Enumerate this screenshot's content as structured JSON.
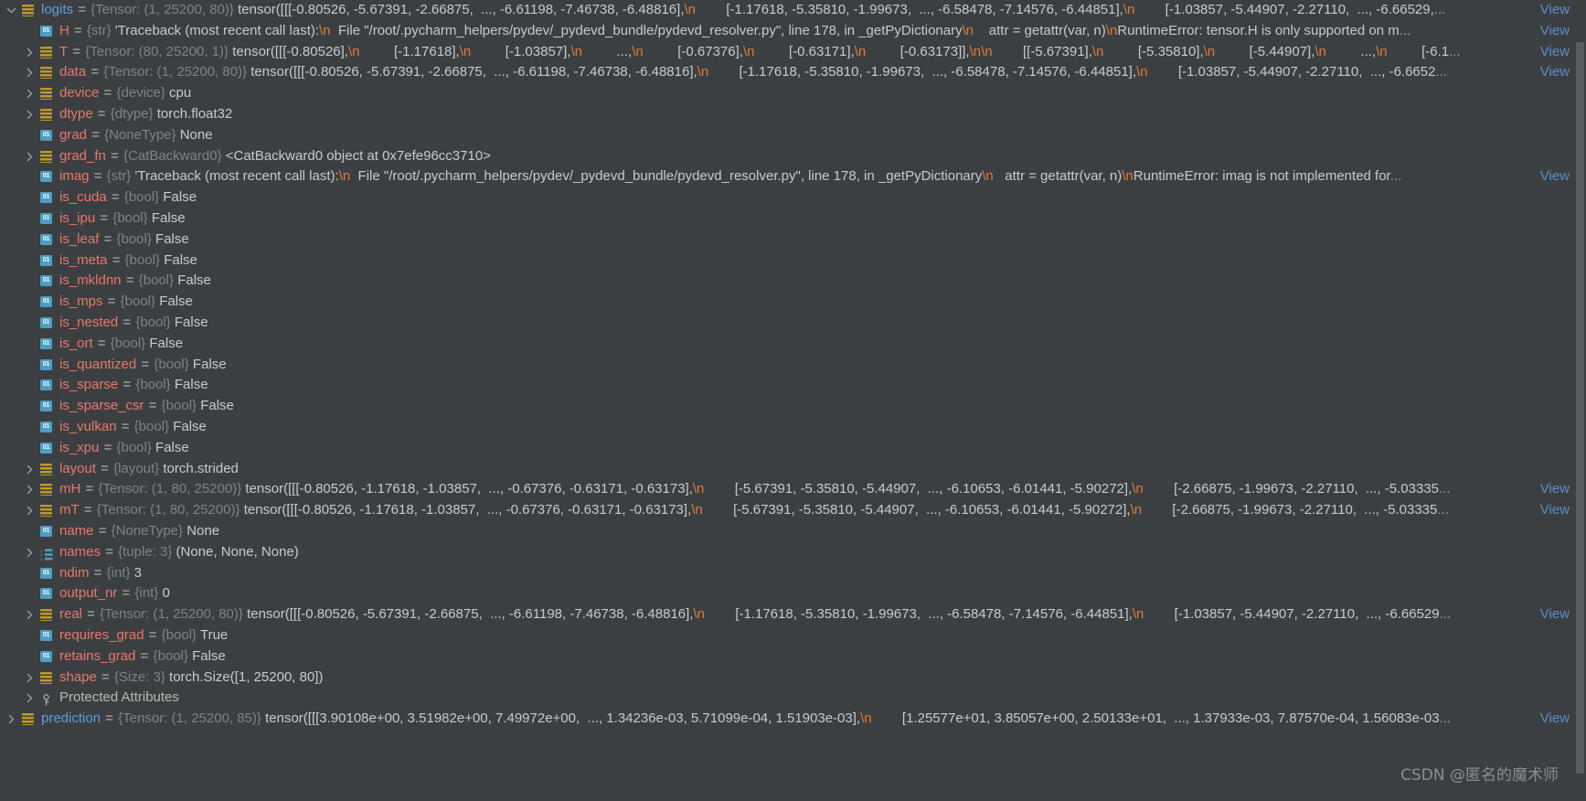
{
  "panel": {
    "title": "Debugger Variables",
    "background": "#3c3f41",
    "accent_name_color": "#e8786e",
    "accent_top_color": "#5f9ee0",
    "type_color": "#7f8386",
    "value_color": "#c8cbcd",
    "escape_color": "#e07a3a",
    "link_color": "#5b8fc9"
  },
  "labels": {
    "view": "View",
    "ellipsis": "...",
    "equals": "="
  },
  "watermark": "CSDN @匿名的魔术师",
  "rows": [
    {
      "id": "logits",
      "indent": 0,
      "expander": "expanded",
      "icon": "object-icon",
      "name": "logits",
      "name_style": "top",
      "type": "{Tensor: (1, 25200, 80)}",
      "value_parts": [
        {
          "t": "tensor([[[-0.80526, -5.67391, -2.66875,  ..., -6.61198, -7.46738, -6.48816],",
          "k": "v"
        },
        {
          "t": "\\n",
          "k": "e"
        },
        {
          "t": "        [-1.17618, -5.35810, -1.99673,  ..., -6.58478, -7.14576, -6.44851],",
          "k": "v"
        },
        {
          "t": "\\n",
          "k": "e"
        },
        {
          "t": "        [-1.03857, -5.44907, -2.27110,  ..., -6.66529,",
          "k": "v"
        }
      ],
      "truncated": true,
      "view": true
    },
    {
      "id": "H",
      "indent": 1,
      "expander": "none",
      "icon": "primitive-icon",
      "name": "H",
      "name_style": "normal",
      "type": "{str}",
      "value_parts": [
        {
          "t": "'Traceback (most recent call last):",
          "k": "v"
        },
        {
          "t": "\\n",
          "k": "e"
        },
        {
          "t": "  File \"/root/.pycharm_helpers/pydev/_pydevd_bundle/pydevd_resolver.py\", line 178, in _getPyDictionary",
          "k": "v"
        },
        {
          "t": "\\n",
          "k": "e"
        },
        {
          "t": "    attr = getattr(var, n)",
          "k": "v"
        },
        {
          "t": "\\n",
          "k": "e"
        },
        {
          "t": "RuntimeError: tensor.H is only supported on m",
          "k": "v"
        }
      ],
      "truncated": true,
      "view": true
    },
    {
      "id": "T",
      "indent": 1,
      "expander": "collapsed",
      "icon": "object-icon",
      "name": "T",
      "name_style": "normal",
      "type": "{Tensor: (80, 25200, 1)}",
      "value_parts": [
        {
          "t": "tensor([[[-0.80526],",
          "k": "v"
        },
        {
          "t": "\\n",
          "k": "e"
        },
        {
          "t": "         [-1.17618],",
          "k": "v"
        },
        {
          "t": "\\n",
          "k": "e"
        },
        {
          "t": "         [-1.03857],",
          "k": "v"
        },
        {
          "t": "\\n",
          "k": "e"
        },
        {
          "t": "         ...,",
          "k": "v"
        },
        {
          "t": "\\n",
          "k": "e"
        },
        {
          "t": "         [-0.67376],",
          "k": "v"
        },
        {
          "t": "\\n",
          "k": "e"
        },
        {
          "t": "         [-0.63171],",
          "k": "v"
        },
        {
          "t": "\\n",
          "k": "e"
        },
        {
          "t": "         [-0.63173]],",
          "k": "v"
        },
        {
          "t": "\\n",
          "k": "e"
        },
        {
          "t": "\\n",
          "k": "e"
        },
        {
          "t": "        [[-5.67391],",
          "k": "v"
        },
        {
          "t": "\\n",
          "k": "e"
        },
        {
          "t": "         [-5.35810],",
          "k": "v"
        },
        {
          "t": "\\n",
          "k": "e"
        },
        {
          "t": "         [-5.44907],",
          "k": "v"
        },
        {
          "t": "\\n",
          "k": "e"
        },
        {
          "t": "         ...,",
          "k": "v"
        },
        {
          "t": "\\n",
          "k": "e"
        },
        {
          "t": "         [-6.1",
          "k": "v"
        }
      ],
      "truncated": true,
      "view": true
    },
    {
      "id": "data",
      "indent": 1,
      "expander": "collapsed",
      "icon": "object-icon",
      "name": "data",
      "name_style": "normal",
      "type": "{Tensor: (1, 25200, 80)}",
      "value_parts": [
        {
          "t": "tensor([[[-0.80526, -5.67391, -2.66875,  ..., -6.61198, -7.46738, -6.48816],",
          "k": "v"
        },
        {
          "t": "\\n",
          "k": "e"
        },
        {
          "t": "        [-1.17618, -5.35810, -1.99673,  ..., -6.58478, -7.14576, -6.44851],",
          "k": "v"
        },
        {
          "t": "\\n",
          "k": "e"
        },
        {
          "t": "        [-1.03857, -5.44907, -2.27110,  ..., -6.6652",
          "k": "v"
        }
      ],
      "truncated": true,
      "view": true
    },
    {
      "id": "device",
      "indent": 1,
      "expander": "collapsed",
      "icon": "object-icon",
      "name": "device",
      "name_style": "normal",
      "type": "{device}",
      "value_parts": [
        {
          "t": "cpu",
          "k": "v"
        }
      ],
      "truncated": false,
      "view": false
    },
    {
      "id": "dtype",
      "indent": 1,
      "expander": "collapsed",
      "icon": "object-icon",
      "name": "dtype",
      "name_style": "normal",
      "type": "{dtype}",
      "value_parts": [
        {
          "t": "torch.float32",
          "k": "v"
        }
      ],
      "truncated": false,
      "view": false
    },
    {
      "id": "grad",
      "indent": 1,
      "expander": "none",
      "icon": "primitive-icon",
      "name": "grad",
      "name_style": "normal",
      "type": "{NoneType}",
      "value_parts": [
        {
          "t": "None",
          "k": "v"
        }
      ],
      "truncated": false,
      "view": false
    },
    {
      "id": "grad_fn",
      "indent": 1,
      "expander": "collapsed",
      "icon": "object-icon",
      "name": "grad_fn",
      "name_style": "normal",
      "type": "{CatBackward0}",
      "value_parts": [
        {
          "t": "<CatBackward0 object at 0x7efe96cc3710>",
          "k": "v"
        }
      ],
      "truncated": false,
      "view": false
    },
    {
      "id": "imag",
      "indent": 1,
      "expander": "none",
      "icon": "primitive-icon",
      "name": "imag",
      "name_style": "normal",
      "type": "{str}",
      "value_parts": [
        {
          "t": "'Traceback (most recent call last):",
          "k": "v"
        },
        {
          "t": "\\n",
          "k": "e"
        },
        {
          "t": "  File \"/root/.pycharm_helpers/pydev/_pydevd_bundle/pydevd_resolver.py\", line 178, in _getPyDictionary",
          "k": "v"
        },
        {
          "t": "\\n",
          "k": "e"
        },
        {
          "t": "   attr = getattr(var, n)",
          "k": "v"
        },
        {
          "t": "\\n",
          "k": "e"
        },
        {
          "t": "RuntimeError: imag is not implemented for",
          "k": "v"
        }
      ],
      "truncated": true,
      "view": true
    },
    {
      "id": "is_cuda",
      "indent": 1,
      "expander": "none",
      "icon": "primitive-icon",
      "name": "is_cuda",
      "name_style": "normal",
      "type": "{bool}",
      "value_parts": [
        {
          "t": "False",
          "k": "v"
        }
      ],
      "truncated": false,
      "view": false
    },
    {
      "id": "is_ipu",
      "indent": 1,
      "expander": "none",
      "icon": "primitive-icon",
      "name": "is_ipu",
      "name_style": "normal",
      "type": "{bool}",
      "value_parts": [
        {
          "t": "False",
          "k": "v"
        }
      ],
      "truncated": false,
      "view": false
    },
    {
      "id": "is_leaf",
      "indent": 1,
      "expander": "none",
      "icon": "primitive-icon",
      "name": "is_leaf",
      "name_style": "normal",
      "type": "{bool}",
      "value_parts": [
        {
          "t": "False",
          "k": "v"
        }
      ],
      "truncated": false,
      "view": false
    },
    {
      "id": "is_meta",
      "indent": 1,
      "expander": "none",
      "icon": "primitive-icon",
      "name": "is_meta",
      "name_style": "normal",
      "type": "{bool}",
      "value_parts": [
        {
          "t": "False",
          "k": "v"
        }
      ],
      "truncated": false,
      "view": false
    },
    {
      "id": "is_mkldnn",
      "indent": 1,
      "expander": "none",
      "icon": "primitive-icon",
      "name": "is_mkldnn",
      "name_style": "normal",
      "type": "{bool}",
      "value_parts": [
        {
          "t": "False",
          "k": "v"
        }
      ],
      "truncated": false,
      "view": false
    },
    {
      "id": "is_mps",
      "indent": 1,
      "expander": "none",
      "icon": "primitive-icon",
      "name": "is_mps",
      "name_style": "normal",
      "type": "{bool}",
      "value_parts": [
        {
          "t": "False",
          "k": "v"
        }
      ],
      "truncated": false,
      "view": false
    },
    {
      "id": "is_nested",
      "indent": 1,
      "expander": "none",
      "icon": "primitive-icon",
      "name": "is_nested",
      "name_style": "normal",
      "type": "{bool}",
      "value_parts": [
        {
          "t": "False",
          "k": "v"
        }
      ],
      "truncated": false,
      "view": false
    },
    {
      "id": "is_ort",
      "indent": 1,
      "expander": "none",
      "icon": "primitive-icon",
      "name": "is_ort",
      "name_style": "normal",
      "type": "{bool}",
      "value_parts": [
        {
          "t": "False",
          "k": "v"
        }
      ],
      "truncated": false,
      "view": false
    },
    {
      "id": "is_quantized",
      "indent": 1,
      "expander": "none",
      "icon": "primitive-icon",
      "name": "is_quantized",
      "name_style": "normal",
      "type": "{bool}",
      "value_parts": [
        {
          "t": "False",
          "k": "v"
        }
      ],
      "truncated": false,
      "view": false
    },
    {
      "id": "is_sparse",
      "indent": 1,
      "expander": "none",
      "icon": "primitive-icon",
      "name": "is_sparse",
      "name_style": "normal",
      "type": "{bool}",
      "value_parts": [
        {
          "t": "False",
          "k": "v"
        }
      ],
      "truncated": false,
      "view": false
    },
    {
      "id": "is_sparse_csr",
      "indent": 1,
      "expander": "none",
      "icon": "primitive-icon",
      "name": "is_sparse_csr",
      "name_style": "normal",
      "type": "{bool}",
      "value_parts": [
        {
          "t": "False",
          "k": "v"
        }
      ],
      "truncated": false,
      "view": false
    },
    {
      "id": "is_vulkan",
      "indent": 1,
      "expander": "none",
      "icon": "primitive-icon",
      "name": "is_vulkan",
      "name_style": "normal",
      "type": "{bool}",
      "value_parts": [
        {
          "t": "False",
          "k": "v"
        }
      ],
      "truncated": false,
      "view": false
    },
    {
      "id": "is_xpu",
      "indent": 1,
      "expander": "none",
      "icon": "primitive-icon",
      "name": "is_xpu",
      "name_style": "normal",
      "type": "{bool}",
      "value_parts": [
        {
          "t": "False",
          "k": "v"
        }
      ],
      "truncated": false,
      "view": false
    },
    {
      "id": "layout",
      "indent": 1,
      "expander": "collapsed",
      "icon": "object-icon",
      "name": "layout",
      "name_style": "normal",
      "type": "{layout}",
      "value_parts": [
        {
          "t": "torch.strided",
          "k": "v"
        }
      ],
      "truncated": false,
      "view": false
    },
    {
      "id": "mH",
      "indent": 1,
      "expander": "collapsed",
      "icon": "object-icon",
      "name": "mH",
      "name_style": "normal",
      "type": "{Tensor: (1, 80, 25200)}",
      "value_parts": [
        {
          "t": "tensor([[[-0.80526, -1.17618, -1.03857,  ..., -0.67376, -0.63171, -0.63173],",
          "k": "v"
        },
        {
          "t": "\\n",
          "k": "e"
        },
        {
          "t": "        [-5.67391, -5.35810, -5.44907,  ..., -6.10653, -6.01441, -5.90272],",
          "k": "v"
        },
        {
          "t": "\\n",
          "k": "e"
        },
        {
          "t": "        [-2.66875, -1.99673, -2.27110,  ..., -5.03335",
          "k": "v"
        }
      ],
      "truncated": true,
      "view": true
    },
    {
      "id": "mT",
      "indent": 1,
      "expander": "collapsed",
      "icon": "object-icon",
      "name": "mT",
      "name_style": "normal",
      "type": "{Tensor: (1, 80, 25200)}",
      "value_parts": [
        {
          "t": "tensor([[[-0.80526, -1.17618, -1.03857,  ..., -0.67376, -0.63171, -0.63173],",
          "k": "v"
        },
        {
          "t": "\\n",
          "k": "e"
        },
        {
          "t": "        [-5.67391, -5.35810, -5.44907,  ..., -6.10653, -6.01441, -5.90272],",
          "k": "v"
        },
        {
          "t": "\\n",
          "k": "e"
        },
        {
          "t": "        [-2.66875, -1.99673, -2.27110,  ..., -5.03335",
          "k": "v"
        }
      ],
      "truncated": true,
      "view": true
    },
    {
      "id": "name",
      "indent": 1,
      "expander": "none",
      "icon": "primitive-icon",
      "name": "name",
      "name_style": "normal",
      "type": "{NoneType}",
      "value_parts": [
        {
          "t": "None",
          "k": "v"
        }
      ],
      "truncated": false,
      "view": false
    },
    {
      "id": "names",
      "indent": 1,
      "expander": "collapsed",
      "icon": "collection-icon",
      "name": "names",
      "name_style": "normal",
      "type": "{tuple: 3}",
      "value_parts": [
        {
          "t": "(None, None, None)",
          "k": "v"
        }
      ],
      "truncated": false,
      "view": false
    },
    {
      "id": "ndim",
      "indent": 1,
      "expander": "none",
      "icon": "primitive-icon",
      "name": "ndim",
      "name_style": "normal",
      "type": "{int}",
      "value_parts": [
        {
          "t": "3",
          "k": "v"
        }
      ],
      "truncated": false,
      "view": false
    },
    {
      "id": "output_nr",
      "indent": 1,
      "expander": "none",
      "icon": "primitive-icon",
      "name": "output_nr",
      "name_style": "normal",
      "type": "{int}",
      "value_parts": [
        {
          "t": "0",
          "k": "v"
        }
      ],
      "truncated": false,
      "view": false
    },
    {
      "id": "real",
      "indent": 1,
      "expander": "collapsed",
      "icon": "object-icon",
      "name": "real",
      "name_style": "normal",
      "type": "{Tensor: (1, 25200, 80)}",
      "value_parts": [
        {
          "t": "tensor([[[-0.80526, -5.67391, -2.66875,  ..., -6.61198, -7.46738, -6.48816],",
          "k": "v"
        },
        {
          "t": "\\n",
          "k": "e"
        },
        {
          "t": "        [-1.17618, -5.35810, -1.99673,  ..., -6.58478, -7.14576, -6.44851],",
          "k": "v"
        },
        {
          "t": "\\n",
          "k": "e"
        },
        {
          "t": "        [-1.03857, -5.44907, -2.27110,  ..., -6.66529",
          "k": "v"
        }
      ],
      "truncated": true,
      "view": true
    },
    {
      "id": "requires_grad",
      "indent": 1,
      "expander": "none",
      "icon": "primitive-icon",
      "name": "requires_grad",
      "name_style": "normal",
      "type": "{bool}",
      "value_parts": [
        {
          "t": "True",
          "k": "v"
        }
      ],
      "truncated": false,
      "view": false
    },
    {
      "id": "retains_grad",
      "indent": 1,
      "expander": "none",
      "icon": "primitive-icon",
      "name": "retains_grad",
      "name_style": "normal",
      "type": "{bool}",
      "value_parts": [
        {
          "t": "False",
          "k": "v"
        }
      ],
      "truncated": false,
      "view": false
    },
    {
      "id": "shape",
      "indent": 1,
      "expander": "collapsed",
      "icon": "object-icon",
      "name": "shape",
      "name_style": "normal",
      "type": "{Size: 3}",
      "value_parts": [
        {
          "t": "torch.Size([1, 25200, 80])",
          "k": "v"
        }
      ],
      "truncated": false,
      "view": false
    },
    {
      "id": "protected-attributes",
      "indent": 1,
      "expander": "collapsed",
      "icon": "key-icon",
      "name": "Protected Attributes",
      "name_style": "group",
      "type": "",
      "value_parts": [],
      "truncated": false,
      "view": false
    },
    {
      "id": "prediction",
      "indent": 0,
      "expander": "collapsed",
      "icon": "object-icon",
      "name": "prediction",
      "name_style": "top",
      "type": "{Tensor: (1, 25200, 85)}",
      "value_parts": [
        {
          "t": "tensor([[[3.90108e+00, 3.51982e+00, 7.49972e+00,  ..., 1.34236e-03, 5.71099e-04, 1.51903e-03],",
          "k": "v"
        },
        {
          "t": "\\n",
          "k": "e"
        },
        {
          "t": "        [1.25577e+01, 3.85057e+00, 2.50133e+01,  ..., 1.37933e-03, 7.87570e-04, 1.56083e-03",
          "k": "v"
        }
      ],
      "truncated": true,
      "view": true
    }
  ]
}
